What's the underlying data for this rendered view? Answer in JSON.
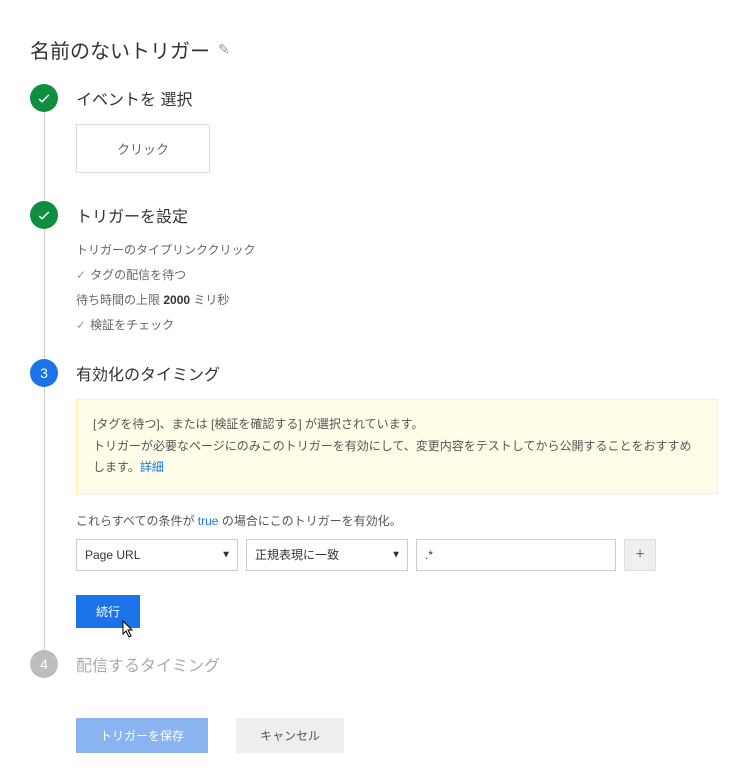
{
  "title": "名前のないトリガー",
  "steps": {
    "s1": {
      "title": "イベントを 選択",
      "event_label": "クリック"
    },
    "s2": {
      "title": "トリガーを設定",
      "line1_prefix": "トリガーのタイプ",
      "line1_value": "リンククリック",
      "line2": "タグの配信を待つ",
      "line3_prefix": "待ち時間の上限",
      "line3_value": "2000",
      "line3_unit": "ミリ秒",
      "line4": "検証をチェック"
    },
    "s3": {
      "title": "有効化のタイミング",
      "number": "3",
      "notice_l1": "[タグを待つ]、または [検証を確認する] が選択されています。",
      "notice_l2": "トリガーが必要なページにのみこのトリガーを有効にして、変更内容をテストしてから公開することをおすすめします。",
      "notice_link": "詳細",
      "cond_label_pre": "これらすべての条件が",
      "cond_label_true": "true",
      "cond_label_post": "の場合にこのトリガーを有効化。",
      "var_select": "Page URL",
      "op_select": "正規表現に一致",
      "value_input": ".*",
      "add_label": "+",
      "continue_label": "続行"
    },
    "s4": {
      "title": "配信するタイミング",
      "number": "4"
    }
  },
  "footer": {
    "save_label": "トリガーを保存",
    "cancel_label": "キャンセル"
  }
}
